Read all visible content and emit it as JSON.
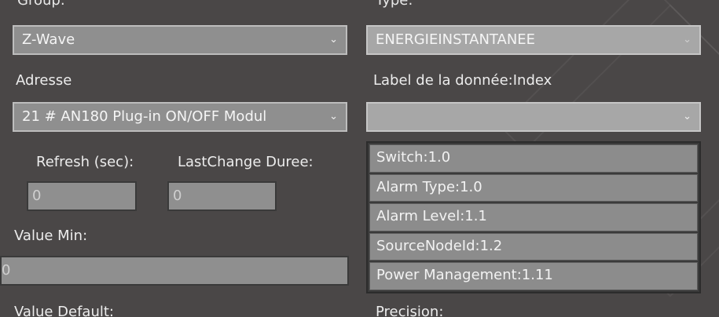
{
  "top_labels": {
    "left": "Group:",
    "right": "Type:"
  },
  "driver_select": {
    "value": "Z-Wave"
  },
  "type_select": {
    "value": "ENERGIEINSTANTANEE"
  },
  "address": {
    "label": "Adresse",
    "value": "21 # AN180 Plug-in ON/OFF Modul"
  },
  "data_label": {
    "label": "Label de la donnée:Index",
    "value": ""
  },
  "refresh": {
    "label": "Refresh (sec):",
    "value": "0"
  },
  "lastchange": {
    "label": "LastChange Duree:",
    "value": "0"
  },
  "value_min": {
    "label": "Value Min:",
    "value": "0"
  },
  "bottom_labels": {
    "value_default": "Value Default:",
    "precision": "Precision:"
  },
  "dropdown_options": [
    "Switch:1.0",
    "Alarm Type:1.0",
    "Alarm Level:1.1",
    "SourceNodeId:1.2",
    "Power Management:1.11"
  ],
  "icons": {
    "chevron": "chevron-down-icon"
  }
}
